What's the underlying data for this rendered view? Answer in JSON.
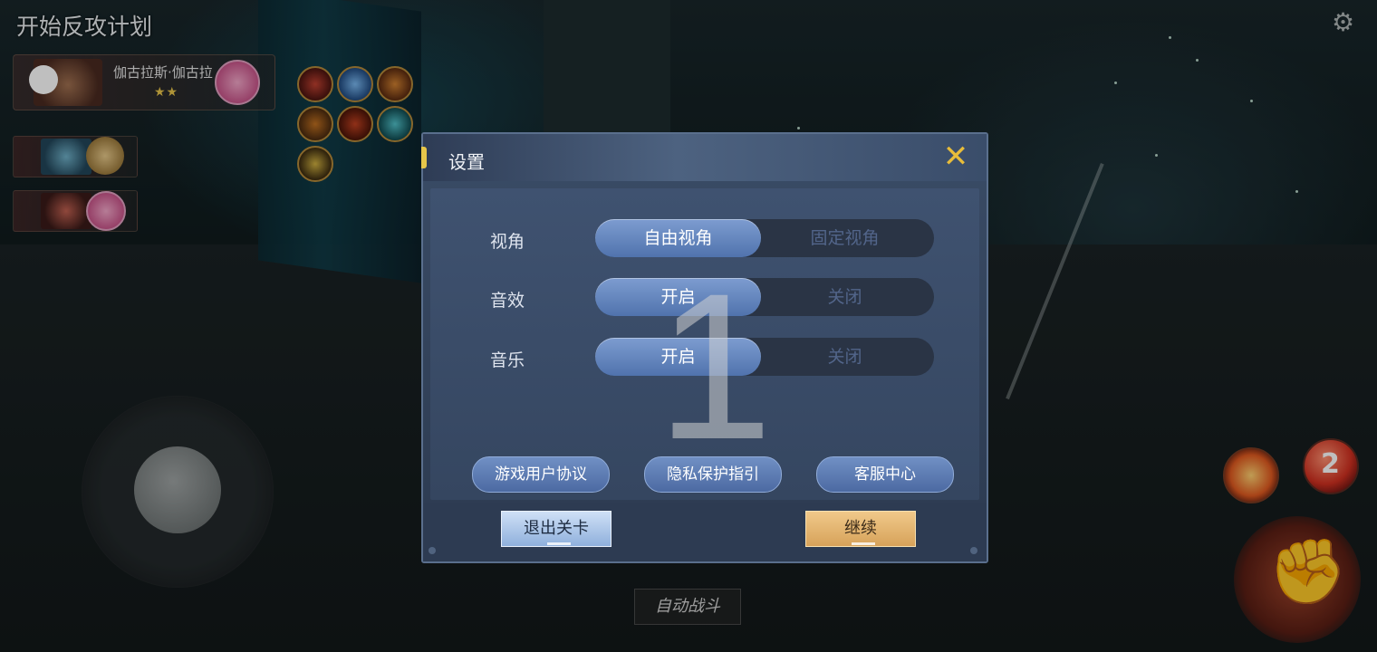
{
  "hud": {
    "mission_title": "开始反攻计划",
    "hero_name": "伽古拉斯·伽古拉",
    "hero_stars": "★★",
    "auto_battle": "自动战斗",
    "orb_count": "2"
  },
  "settings": {
    "title": "设置",
    "close_label": "✕",
    "rows": [
      {
        "label": "视角",
        "on": "自由视角",
        "off": "固定视角"
      },
      {
        "label": "音效",
        "on": "开启",
        "off": "关闭"
      },
      {
        "label": "音乐",
        "on": "开启",
        "off": "关闭"
      }
    ],
    "links": [
      "游戏用户协议",
      "隐私保护指引",
      "客服中心"
    ],
    "exit_label": "退出关卡",
    "continue_label": "继续",
    "overlay_number": "1"
  },
  "colors": {
    "accent_gold": "#e8bc3a",
    "toggle_on": "#5b7fbd",
    "continue": "#e2b06a"
  }
}
